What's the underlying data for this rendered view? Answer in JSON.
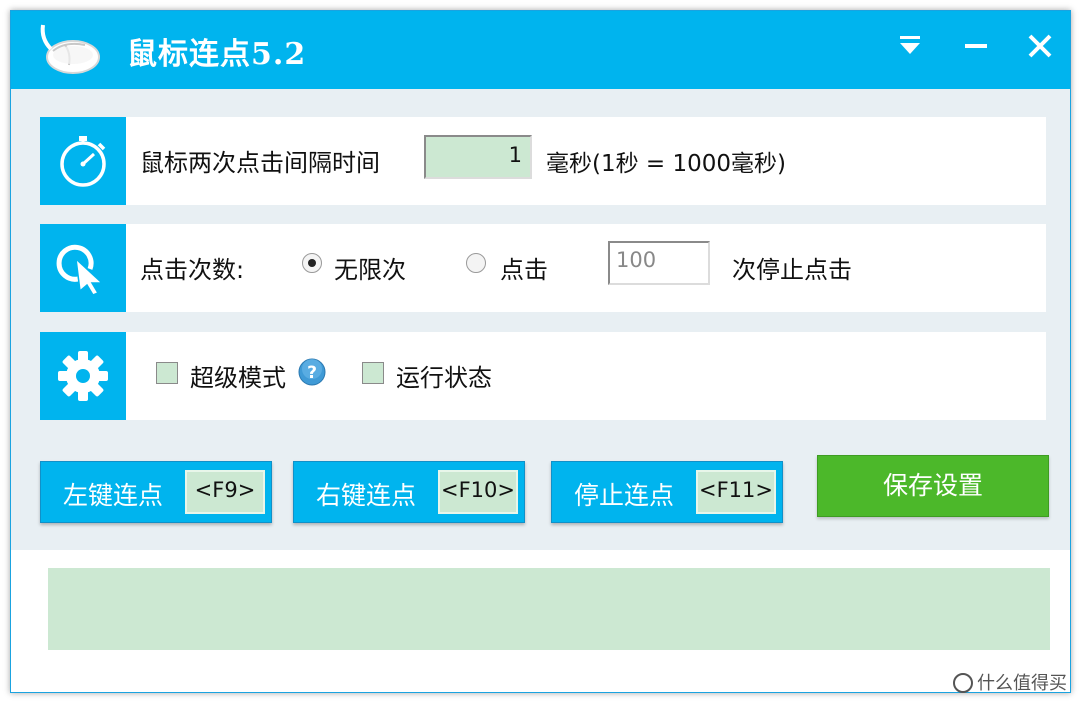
{
  "window": {
    "title": "鼠标连点5.2",
    "accent_color": "#00b4ee",
    "save_color": "#4cb82a",
    "input_color": "#cce8d2"
  },
  "titlebar_controls": {
    "menu_icon": "dropdown-menu-icon",
    "minimize_icon": "minimize-icon",
    "close_icon": "close-icon"
  },
  "interval": {
    "icon": "stopwatch-icon",
    "label": "鼠标两次点击间隔时间",
    "value": "1",
    "unit": "毫秒(1秒 = 1000毫秒)"
  },
  "click_count": {
    "icon": "cursor-click-icon",
    "label": "点击次数:",
    "option_unlimited": "无限次",
    "option_limited": "点击",
    "selected": "无限次",
    "count_value": "100",
    "suffix": "次停止点击"
  },
  "settings": {
    "icon": "gear-icon",
    "super_mode_label": "超级模式",
    "super_mode_checked": false,
    "help_icon": "help-icon",
    "run_status_label": "运行状态",
    "run_status_checked": false
  },
  "actions": {
    "left_click": {
      "label": "左键连点",
      "hotkey": "<F9>"
    },
    "right_click": {
      "label": "右键连点",
      "hotkey": "<F10>"
    },
    "stop_click": {
      "label": "停止连点",
      "hotkey": "<F11>"
    },
    "save_label": "保存设置"
  },
  "watermark": {
    "text": "什么值得买"
  }
}
